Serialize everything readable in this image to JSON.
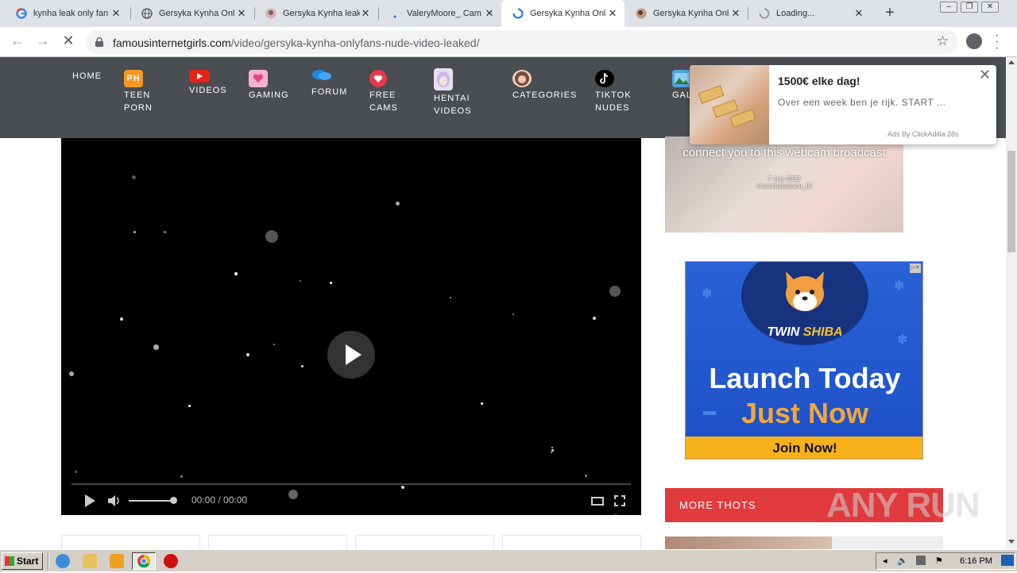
{
  "browser": {
    "tabs": [
      {
        "title": "kynha leak only fan",
        "favicon": "google-g-icon"
      },
      {
        "title": "Gersyka Kynha Onl",
        "favicon": "globe-icon"
      },
      {
        "title": "Gersyka Kynha leak",
        "favicon": "avatar-icon"
      },
      {
        "title": "ValeryMoore_ Cam",
        "favicon": "dot-icon"
      },
      {
        "title": "Gersyka Kynha Onl",
        "favicon": "loading-spinner-icon",
        "active": true
      },
      {
        "title": "Gersyka Kynha Onl",
        "favicon": "avatar-icon"
      },
      {
        "title": "Loading...",
        "favicon": "loading-spinner-icon"
      }
    ],
    "new_tab_label": "+",
    "url_domain": "famousinternetgirls.com",
    "url_path": "/video/gersyka-kynha-onlyfans-nude-video-leaked/"
  },
  "site_nav": {
    "home": "HOME",
    "teen_porn": {
      "icon": "PH",
      "line1": "TEEN",
      "line2": "PORN"
    },
    "videos": "VIDEOS",
    "gaming": "GAMING",
    "forum": "FORUM",
    "free_cams": {
      "line1": "FREE",
      "line2": "CAMS"
    },
    "hentai": {
      "line1": "HENTAI",
      "line2": "VIDEOS"
    },
    "categories": "CATEGORIES",
    "tiktok": {
      "line1": "TIKTOK",
      "line2": "NUDES"
    },
    "gallery_partial": "GAL"
  },
  "video": {
    "time": "00:00 / 00:00"
  },
  "ad_webcam": {
    "line": "connect you to this webcam broadcast",
    "small1": "7 July 2022",
    "small2": "chaturbate/asmr_illi"
  },
  "ad_twinshiba": {
    "brand_a": "TWIN",
    "brand_b": "SHIBA",
    "line1": "Launch Today",
    "line2": "Just Now",
    "cta": "Join Now!"
  },
  "more_thots": "MORE THOTS",
  "popup": {
    "title": "1500€ elke dag!",
    "message": "Over een week ben je rijk. START ...",
    "by": "Ads By ClickAdilla",
    "age": "28s"
  },
  "watermark": "ANY RUN",
  "taskbar": {
    "start": "Start",
    "time": "6:16 PM"
  },
  "colors": {
    "nav_bg": "#4a4d52",
    "more_thots_bg": "#e03a3e",
    "ad_blue": "#2a62d8",
    "ad_cta": "#f7b21b"
  }
}
